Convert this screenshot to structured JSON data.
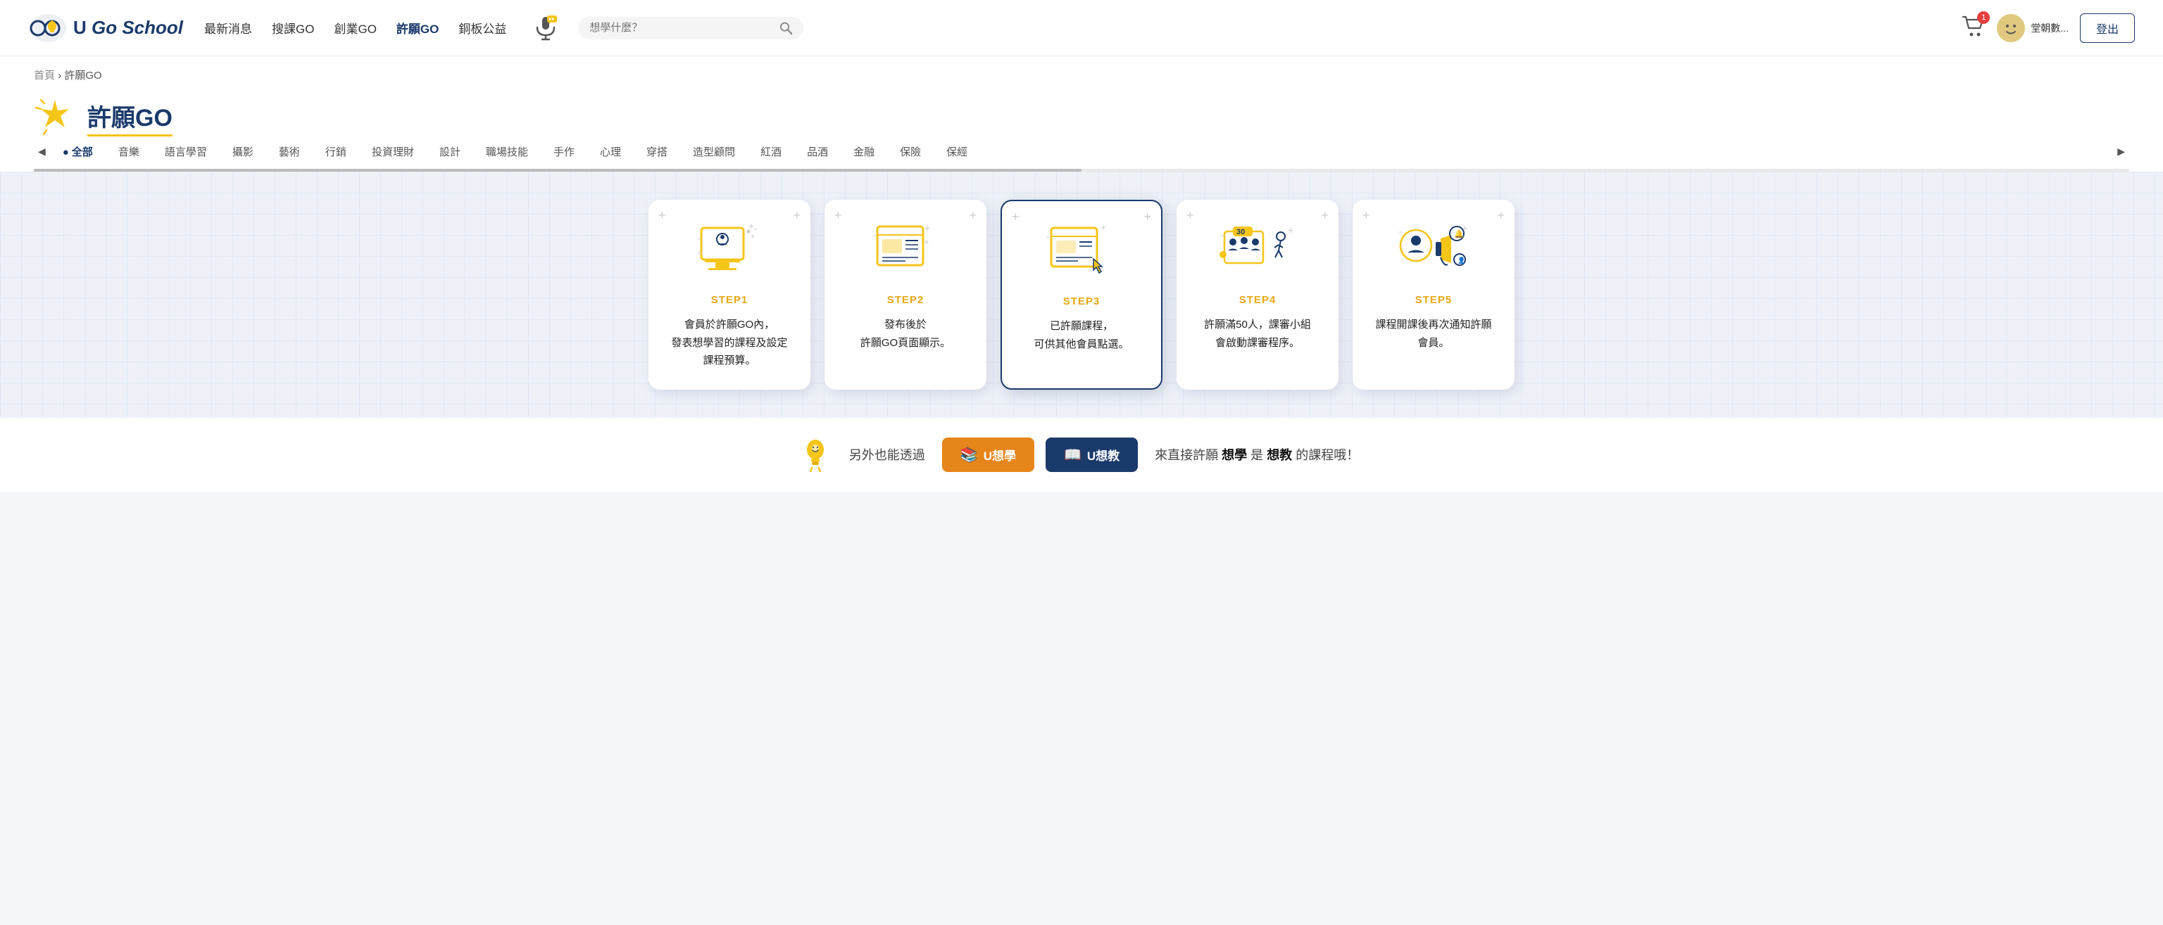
{
  "header": {
    "logo_text_u": "U",
    "logo_text_go": " Go School",
    "nav": [
      {
        "label": "最新消息",
        "key": "news"
      },
      {
        "label": "搜課GO",
        "key": "search-course"
      },
      {
        "label": "創業GO",
        "key": "startup"
      },
      {
        "label": "許願GO",
        "key": "wish"
      },
      {
        "label": "銅板公益",
        "key": "charity"
      }
    ],
    "search_placeholder": "想學什麼？",
    "cart_badge": "1",
    "user_name": "堂朝數...",
    "logout_label": "登出"
  },
  "breadcrumb": {
    "home": "首頁",
    "separator": "›",
    "current": "許願GO"
  },
  "page_title": {
    "label": "許願GO"
  },
  "categories": {
    "items": [
      {
        "label": "全部",
        "active": true
      },
      {
        "label": "音樂",
        "active": false
      },
      {
        "label": "語言學習",
        "active": false
      },
      {
        "label": "攝影",
        "active": false
      },
      {
        "label": "藝術",
        "active": false
      },
      {
        "label": "行銷",
        "active": false
      },
      {
        "label": "投資理財",
        "active": false
      },
      {
        "label": "設計",
        "active": false
      },
      {
        "label": "職場技能",
        "active": false
      },
      {
        "label": "手作",
        "active": false
      },
      {
        "label": "心理",
        "active": false
      },
      {
        "label": "穿搭",
        "active": false
      },
      {
        "label": "造型顧問",
        "active": false
      },
      {
        "label": "紅酒",
        "active": false
      },
      {
        "label": "品酒",
        "active": false
      },
      {
        "label": "金融",
        "active": false
      },
      {
        "label": "保險",
        "active": false
      },
      {
        "label": "保經",
        "active": false
      }
    ]
  },
  "steps": [
    {
      "key": "step1",
      "label": "STEP1",
      "desc": "會員於許願GO內，\n發表想學習的課程及設定\n課程預算。",
      "highlighted": false
    },
    {
      "key": "step2",
      "label": "STEP2",
      "desc": "發布後於\n許願GO頁面顯示。",
      "highlighted": false
    },
    {
      "key": "step3",
      "label": "STEP3",
      "desc": "已許願課程，\n可供其他會員點選。",
      "highlighted": true
    },
    {
      "key": "step4",
      "label": "STEP4",
      "desc": "許願滿50人，課審小組\n會啟動課審程序。",
      "highlighted": false
    },
    {
      "key": "step5",
      "label": "STEP5",
      "desc": "課程開課後再次通知許願\n會員。",
      "highlighted": false
    }
  ],
  "bottom": {
    "prefix_text": "另外也能透過",
    "u_learn_label": "U想學",
    "u_teach_label": "U想教",
    "suffix_text_pre": "來直接許願 ",
    "suffix_bold_learn": "想學",
    "suffix_text_mid": " 是 ",
    "suffix_bold_teach": "想教",
    "suffix_text_end": " 的課程哦！"
  }
}
